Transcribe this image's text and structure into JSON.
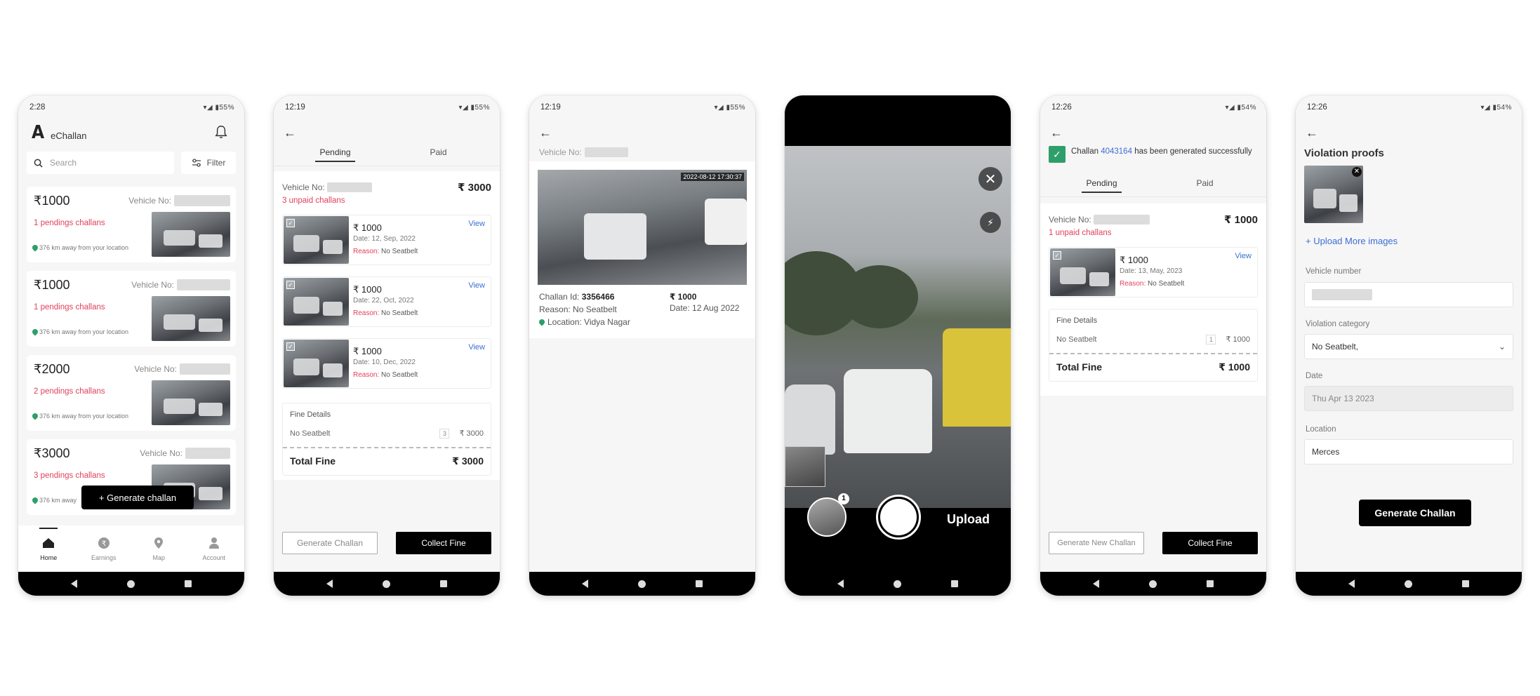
{
  "phone1": {
    "status": {
      "time": "2:28",
      "right": "55%"
    },
    "app_title": "eChallan",
    "logo": "A",
    "search_placeholder": "Search",
    "filter_label": "Filter",
    "vehicle_label": "Vehicle No:",
    "cards": [
      {
        "amount": "₹1000",
        "pending": "1 pendings challans",
        "distance": "376 km away from your location"
      },
      {
        "amount": "₹1000",
        "pending": "1 pendings challans",
        "distance": "376 km away from your location"
      },
      {
        "amount": "₹2000",
        "pending": "2 pendings challans",
        "distance": "376 km away from your location"
      },
      {
        "amount": "₹3000",
        "pending": "3 pendings challans",
        "distance": "376 km away"
      }
    ],
    "generate_button": "+ Generate challan",
    "tabs": [
      "Home",
      "Earnings",
      "Map",
      "Account"
    ]
  },
  "phone2": {
    "status": {
      "time": "12:19",
      "right": "55%"
    },
    "tabs": [
      "Pending",
      "Paid"
    ],
    "vehicle_label": "Vehicle No:",
    "total_top": "₹ 3000",
    "unpaid": "3 unpaid challans",
    "challans": [
      {
        "amount": "₹ 1000",
        "date": "Date: 12, Sep, 2022",
        "reason_label": "Reason:",
        "reason": "No Seatbelt",
        "view": "View"
      },
      {
        "amount": "₹ 1000",
        "date": "Date: 22, Oct, 2022",
        "reason_label": "Reason:",
        "reason": "No Seatbelt",
        "view": "View"
      },
      {
        "amount": "₹ 1000",
        "date": "Date: 10, Dec, 2022",
        "reason_label": "Reason:",
        "reason": "No Seatbelt",
        "view": "View"
      }
    ],
    "fine": {
      "title": "Fine Details",
      "item": "No Seatbelt",
      "qty": "3",
      "amount": "₹ 3000",
      "total_label": "Total Fine",
      "total": "₹ 3000"
    },
    "btn_generate": "Generate Challan",
    "btn_collect": "Collect Fine"
  },
  "phone3": {
    "status": {
      "time": "12:19",
      "right": "55%"
    },
    "vehicle_label": "Vehicle No:",
    "timestamp": "2022-08-12 17:30:37",
    "challan_id_label": "Challan Id:",
    "challan_id": "3356466",
    "amount": "₹ 1000",
    "reason": "Reason: No Seatbelt",
    "date": "Date: 12 Aug 2022",
    "location": "Location: Vidya Nagar"
  },
  "phone4": {
    "gallery_count": "1",
    "upload_label": "Upload"
  },
  "phone5": {
    "status": {
      "time": "12:26",
      "right": "54%"
    },
    "success_prefix": "Challan",
    "challan_id": "4043164",
    "success_suffix": "has been generated successfully",
    "tabs": [
      "Pending",
      "Paid"
    ],
    "vehicle_label": "Vehicle No:",
    "total_top": "₹ 1000",
    "unpaid": "1 unpaid challans",
    "challan": {
      "amount": "₹ 1000",
      "date": "Date: 13, May, 2023",
      "reason_label": "Reason:",
      "reason": "No Seatbelt",
      "view": "View"
    },
    "fine": {
      "title": "Fine Details",
      "item": "No Seatbelt",
      "qty": "1",
      "amount": "₹ 1000",
      "total_label": "Total Fine",
      "total": "₹ 1000"
    },
    "btn_generate": "Generate New Challan",
    "btn_collect": "Collect Fine"
  },
  "phone6": {
    "status": {
      "time": "12:26",
      "right": "54%"
    },
    "title": "Violation proofs",
    "upload_more": "+  Upload More images",
    "vehicle_number_label": "Vehicle number",
    "violation_label": "Violation category",
    "violation_value": "No Seatbelt,",
    "date_label": "Date",
    "date_value": "Thu Apr 13 2023",
    "location_label": "Location",
    "location_value": "Merces",
    "generate_button": "Generate Challan"
  },
  "colors": {
    "accent_red": "#e0415e",
    "link_blue": "#3b6ed6",
    "success_green": "#2e9e6b"
  }
}
